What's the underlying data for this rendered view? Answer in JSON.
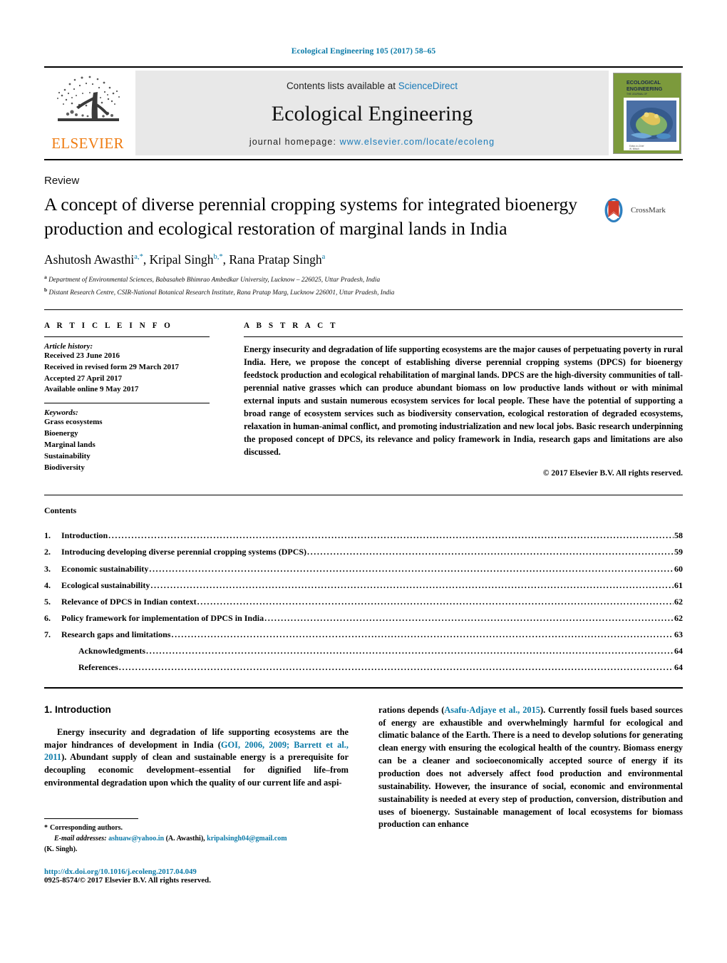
{
  "running_head": "Ecological Engineering 105 (2017) 58–65",
  "masthead": {
    "elsevier_wordmark": "ELSEVIER",
    "contents_prefix": "Contents lists available at ",
    "sciencedirect": "ScienceDirect",
    "journal_title": "Ecological Engineering",
    "homepage_prefix": "journal homepage: ",
    "homepage_url": "www.elsevier.com/locate/ecoleng",
    "cover_line1": "ECOLOGICAL",
    "cover_line2": "ENGINEERING"
  },
  "article": {
    "type": "Review",
    "title": "A concept of diverse perennial cropping systems for integrated bioenergy production and ecological restoration of marginal lands in India",
    "crossmark_label": "CrossMark",
    "authors_html": "Ashutosh Awasthi<sup>a,<span class=\"star\">*</span></sup>, Kripal Singh<sup>b,<span class=\"star\">*</span></sup>, Rana Pratap Singh<sup>a</sup>",
    "affiliations": [
      {
        "marker": "a",
        "text": "Department of Environmental Sciences, Babasaheb Bhimrao Ambedkar University, Lucknow – 226025, Uttar Pradesh, India"
      },
      {
        "marker": "b",
        "text": "Distant Research Centre, CSIR-National Botanical Research Institute, Rana Pratap Marg, Lucknow 226001, Uttar Pradesh, India"
      }
    ]
  },
  "article_info": {
    "heading": "A R T I C L E  I N F O",
    "history_label": "Article history:",
    "history": [
      "Received 23 June 2016",
      "Received in revised form 29 March 2017",
      "Accepted 27 April 2017",
      "Available online 9 May 2017"
    ],
    "keywords_label": "Keywords:",
    "keywords": [
      "Grass ecosystems",
      "Bioenergy",
      "Marginal lands",
      "Sustainability",
      "Biodiversity"
    ]
  },
  "abstract": {
    "heading": "A B S T R A C T",
    "text": "Energy insecurity and degradation of life supporting ecosystems are the major causes of perpetuating poverty in rural India. Here, we propose the concept of establishing diverse perennial cropping systems (DPCS) for bioenergy feedstock production and ecological rehabilitation of marginal lands. DPCS are the high-diversity communities of tall-perennial native grasses which can produce abundant biomass on low productive lands without or with minimal external inputs and sustain numerous ecosystem services for local people. These have the potential of supporting a broad range of ecosystem services such as biodiversity conservation, ecological restoration of degraded ecosystems, relaxation in human-animal conflict, and promoting industrialization and new local jobs. Basic research underpinning the proposed concept of DPCS, its relevance and policy framework in India, research gaps and limitations are also discussed.",
    "copyright": "© 2017 Elsevier B.V. All rights reserved."
  },
  "contents": {
    "title": "Contents",
    "items": [
      {
        "num": "1.",
        "label": "Introduction",
        "page": "58",
        "indent": false
      },
      {
        "num": "2.",
        "label": "Introducing developing diverse perennial cropping systems (DPCS)",
        "page": "59",
        "indent": false
      },
      {
        "num": "3.",
        "label": "Economic sustainability",
        "page": "60",
        "indent": false
      },
      {
        "num": "4.",
        "label": "Ecological sustainability",
        "page": "61",
        "indent": false
      },
      {
        "num": "5.",
        "label": "Relevance of DPCS in Indian context",
        "page": "62",
        "indent": false
      },
      {
        "num": "6.",
        "label": "Policy framework for implementation of DPCS in India",
        "page": "62",
        "indent": false
      },
      {
        "num": "7.",
        "label": "Research gaps and limitations",
        "page": "63",
        "indent": false
      },
      {
        "num": "",
        "label": "Acknowledgments",
        "page": "64",
        "indent": true
      },
      {
        "num": "",
        "label": "References",
        "page": "64",
        "indent": true
      }
    ],
    "dot_filler": "........................................................................................................................................................................................................"
  },
  "introduction": {
    "heading": "1.  Introduction",
    "left_part1": "Energy insecurity and degradation of life supporting ecosystems are the major hindrances of development in India (",
    "left_cite1": "GOI, 2006, 2009; Barrett et al., 2011",
    "left_part2": "). Abundant supply of clean and sustainable energy is a prerequisite for decoupling economic development–essential for dignified life–from environmental degradation upon which the quality of our current life and aspi-",
    "right_part1": "rations depends (",
    "right_cite1": "Asafu-Adjaye et al., 2015",
    "right_part2": "). Currently fossil fuels based sources of energy are exhaustible and overwhelmingly harmful for ecological and climatic balance of the Earth. There is a need to develop solutions for generating clean energy with ensuring the ecological health of the country. Biomass energy can be a cleaner and socioeconomically accepted source of energy if its production does not adversely affect food production and environmental sustainability. However, the insurance of social, economic and environmental sustainability is needed at every step of production, conversion, distribution and uses of bioenergy. Sustainable management of local ecosystems for biomass production can enhance"
  },
  "footnotes": {
    "corresponding": "Corresponding authors.",
    "star": "*",
    "email_label": "E-mail addresses:",
    "email1": "ashuaw@yahoo.in",
    "email1_owner": "(A. Awasthi),",
    "email2": "kripalsingh04@gmail.com",
    "email2_owner": "(K. Singh).",
    "doi": "http://dx.doi.org/10.1016/j.ecoleng.2017.04.049",
    "issn": "0925-8574/© 2017 Elsevier B.V. All rights reserved."
  },
  "colors": {
    "link_blue": "#0b7aa8",
    "sciencedirect_blue": "#1a7bb9",
    "elsevier_orange": "#ef7c12",
    "masthead_gray": "#e8e8e8"
  }
}
